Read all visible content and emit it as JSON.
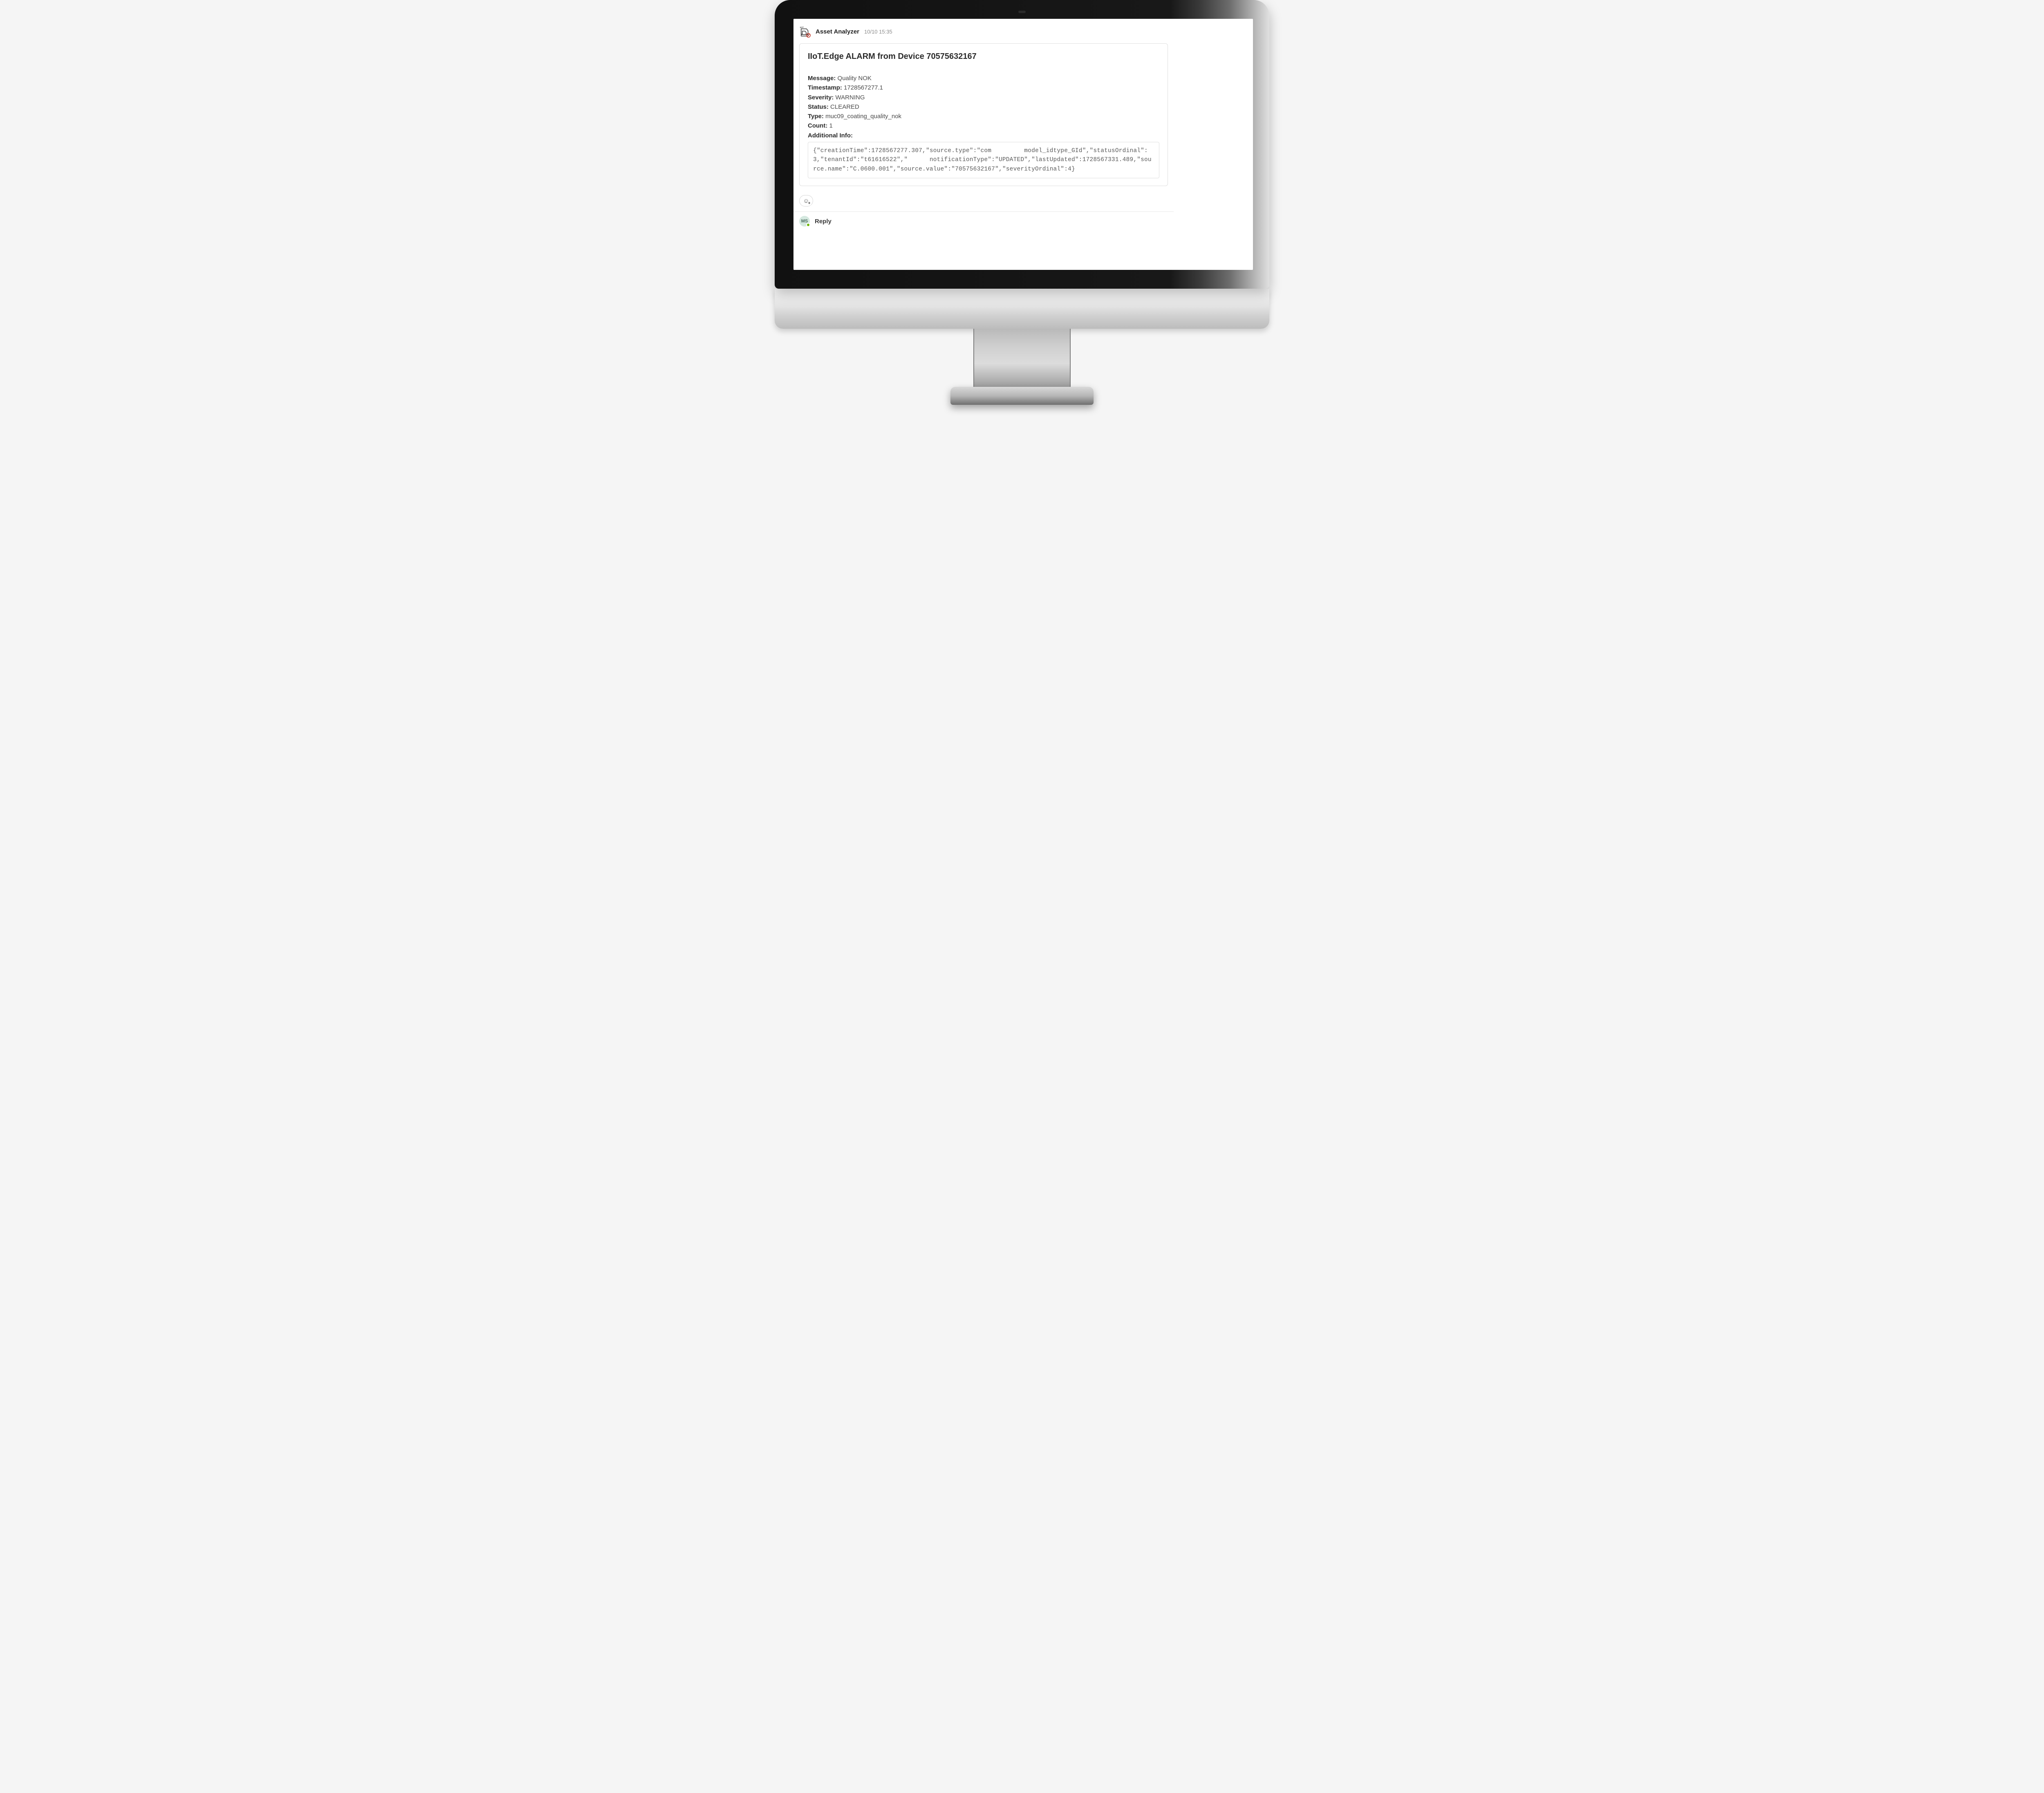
{
  "header": {
    "sender_name": "Asset Analyzer",
    "timestamp": "10/10 15:35",
    "bot_label_top": "IIOT"
  },
  "card": {
    "title": "IIoT.Edge ALARM from Device 70575632167",
    "fields": {
      "message": {
        "label": "Message:",
        "value": "Quality NOK"
      },
      "timestamp": {
        "label": "Timestamp:",
        "value": "1728567277.1"
      },
      "severity": {
        "label": "Severity:",
        "value": "WARNING"
      },
      "status": {
        "label": "Status:",
        "value": "CLEARED"
      },
      "type": {
        "label": "Type:",
        "value": "muc09_coating_quality_nok"
      },
      "count": {
        "label": "Count:",
        "value": "1"
      },
      "addl": {
        "label": "Additional Info:"
      }
    },
    "additional_info_raw": "{\"creationTime\":1728567277.307,\"source.type\":\"com         model_idtype_GId\",\"statusOrdinal\":3,\"tenantId\":\"t61616522\",\"      notificationType\":\"UPDATED\",\"lastUpdated\":1728567331.489,\"source.name\":\"C.0600.001\",\"source.value\":\"70575632167\",\"severityOrdinal\":4}"
  },
  "reply": {
    "avatar_initials": "MS",
    "label": "Reply"
  }
}
